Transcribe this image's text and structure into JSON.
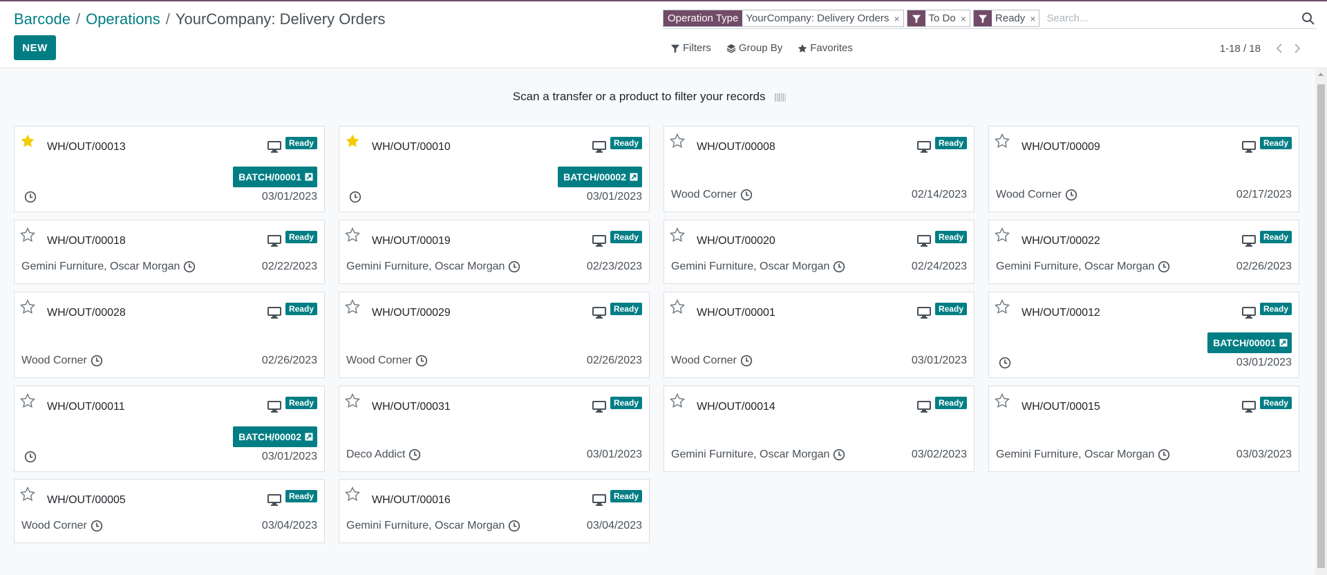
{
  "breadcrumb": {
    "root": "Barcode",
    "middle": "Operations",
    "current": "YourCompany: Delivery Orders",
    "sep": "/"
  },
  "actions": {
    "new_label": "NEW"
  },
  "search": {
    "facets": [
      {
        "key": "Operation Type",
        "value": "YourCompany: Delivery Orders",
        "close": "×"
      },
      {
        "key_icon": "filter-icon",
        "value": "To Do",
        "close": "×"
      },
      {
        "key_icon": "filter-icon",
        "value": "Ready",
        "close": "×"
      }
    ],
    "placeholder": "Search..."
  },
  "filters": {
    "filters_label": "Filters",
    "groupby_label": "Group By",
    "favorites_label": "Favorites"
  },
  "pager": {
    "value": "1-18 / 18"
  },
  "banner": {
    "text": "Scan a transfer or a product to filter your records",
    "icon": "barcode-icon"
  },
  "colors": {
    "brand": "#714B67",
    "accent": "#017e84",
    "star_active": "#f3cc00"
  },
  "cards": [
    {
      "ref": "WH/OUT/00013",
      "starred": true,
      "status": "Ready",
      "partner": "",
      "batch": "BATCH/00001",
      "date": "03/01/2023"
    },
    {
      "ref": "WH/OUT/00010",
      "starred": true,
      "status": "Ready",
      "partner": "",
      "batch": "BATCH/00002",
      "date": "03/01/2023"
    },
    {
      "ref": "WH/OUT/00008",
      "starred": false,
      "status": "Ready",
      "partner": "Wood Corner",
      "batch": "",
      "date": "02/14/2023"
    },
    {
      "ref": "WH/OUT/00009",
      "starred": false,
      "status": "Ready",
      "partner": "Wood Corner",
      "batch": "",
      "date": "02/17/2023"
    },
    {
      "ref": "WH/OUT/00018",
      "starred": false,
      "status": "Ready",
      "partner": "Gemini Furniture, Oscar Morgan",
      "batch": "",
      "date": "02/22/2023"
    },
    {
      "ref": "WH/OUT/00019",
      "starred": false,
      "status": "Ready",
      "partner": "Gemini Furniture, Oscar Morgan",
      "batch": "",
      "date": "02/23/2023"
    },
    {
      "ref": "WH/OUT/00020",
      "starred": false,
      "status": "Ready",
      "partner": "Gemini Furniture, Oscar Morgan",
      "batch": "",
      "date": "02/24/2023"
    },
    {
      "ref": "WH/OUT/00022",
      "starred": false,
      "status": "Ready",
      "partner": "Gemini Furniture, Oscar Morgan",
      "batch": "",
      "date": "02/26/2023"
    },
    {
      "ref": "WH/OUT/00028",
      "starred": false,
      "status": "Ready",
      "partner": "Wood Corner",
      "batch": "",
      "date": "02/26/2023"
    },
    {
      "ref": "WH/OUT/00029",
      "starred": false,
      "status": "Ready",
      "partner": "Wood Corner",
      "batch": "",
      "date": "02/26/2023"
    },
    {
      "ref": "WH/OUT/00001",
      "starred": false,
      "status": "Ready",
      "partner": "Wood Corner",
      "batch": "",
      "date": "03/01/2023"
    },
    {
      "ref": "WH/OUT/00012",
      "starred": false,
      "status": "Ready",
      "partner": "",
      "batch": "BATCH/00001",
      "date": "03/01/2023"
    },
    {
      "ref": "WH/OUT/00011",
      "starred": false,
      "status": "Ready",
      "partner": "",
      "batch": "BATCH/00002",
      "date": "03/01/2023"
    },
    {
      "ref": "WH/OUT/00031",
      "starred": false,
      "status": "Ready",
      "partner": "Deco Addict",
      "batch": "",
      "date": "03/01/2023"
    },
    {
      "ref": "WH/OUT/00014",
      "starred": false,
      "status": "Ready",
      "partner": "Gemini Furniture, Oscar Morgan",
      "batch": "",
      "date": "03/02/2023"
    },
    {
      "ref": "WH/OUT/00015",
      "starred": false,
      "status": "Ready",
      "partner": "Gemini Furniture, Oscar Morgan",
      "batch": "",
      "date": "03/03/2023"
    },
    {
      "ref": "WH/OUT/00005",
      "starred": false,
      "status": "Ready",
      "partner": "Wood Corner",
      "batch": "",
      "date": "03/04/2023"
    },
    {
      "ref": "WH/OUT/00016",
      "starred": false,
      "status": "Ready",
      "partner": "Gemini Furniture, Oscar Morgan",
      "batch": "",
      "date": "03/04/2023"
    }
  ]
}
